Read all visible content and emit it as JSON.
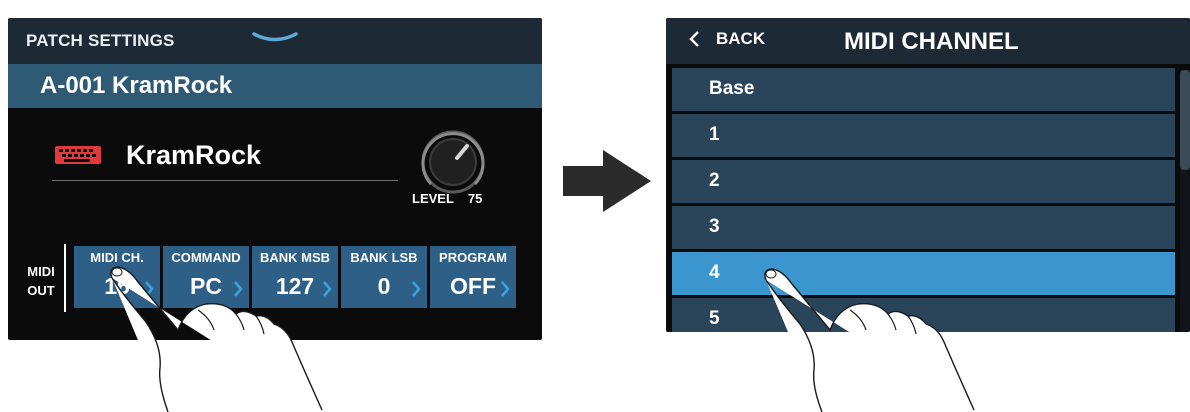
{
  "left_screen": {
    "header_title": "PATCH SETTINGS",
    "patch_title": "A-001 KramRock",
    "patch_name": "KramRock",
    "icons": {
      "patch_type": "keyboard-icon",
      "header": "chevron-down-icon",
      "level": "knob-icon"
    },
    "level": {
      "label": "LEVEL",
      "value": "75"
    },
    "midi_out": {
      "line1": "MIDI",
      "line2": "OUT"
    },
    "params": [
      {
        "label": "MIDI CH.",
        "value": "16"
      },
      {
        "label": "COMMAND",
        "value": "PC"
      },
      {
        "label": "BANK MSB",
        "value": "127"
      },
      {
        "label": "BANK LSB",
        "value": "0"
      },
      {
        "label": "PROGRAM",
        "value": "OFF"
      }
    ]
  },
  "right_screen": {
    "back_label": "BACK",
    "title": "MIDI CHANNEL",
    "items": [
      "Base",
      "1",
      "2",
      "3",
      "4",
      "5"
    ],
    "selected_item": "4"
  },
  "colors": {
    "header_bg": "#1d2a36",
    "patch_bar": "#2f5a76",
    "param_cell": "#2e5f86",
    "list_item": "#2a4459",
    "selected": "#3b95cf",
    "accent_arrow": "#3aa3e0",
    "keyboard_icon": "#e0393e"
  }
}
